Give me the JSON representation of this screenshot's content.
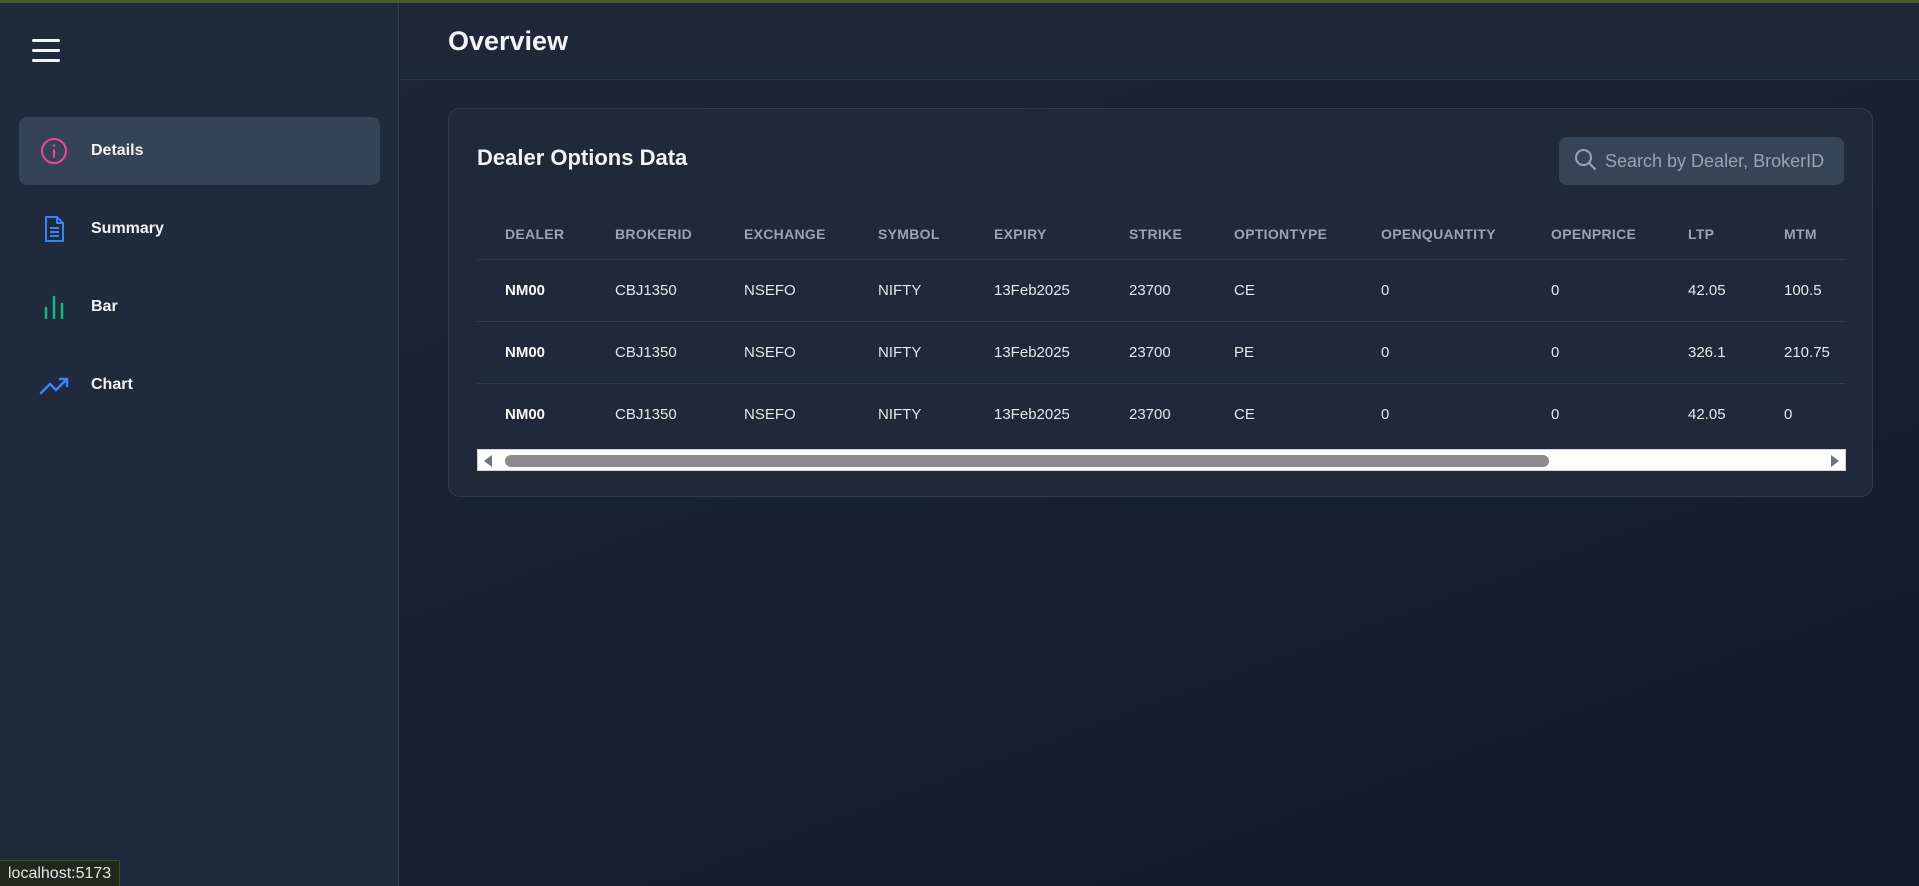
{
  "status_url": "localhost:5173",
  "sidebar": {
    "menu_icon": "hamburger-icon",
    "items": [
      {
        "label": "Details",
        "icon": "info-icon",
        "color": "#ec4899",
        "active": true
      },
      {
        "label": "Summary",
        "icon": "document-icon",
        "color": "#3b82f6",
        "active": false
      },
      {
        "label": "Bar",
        "icon": "bar-chart-icon",
        "color": "#10b981",
        "active": false
      },
      {
        "label": "Chart",
        "icon": "trending-up-icon",
        "color": "#3b82f6",
        "active": false
      }
    ]
  },
  "header": {
    "title": "Overview"
  },
  "card": {
    "title": "Dealer Options Data",
    "search": {
      "placeholder": "Search by Dealer, BrokerID",
      "value": "",
      "icon": "search-icon"
    }
  },
  "table": {
    "columns": [
      "DEALER",
      "BROKERID",
      "EXCHANGE",
      "SYMBOL",
      "EXPIRY",
      "STRIKE",
      "OPTIONTYPE",
      "OPENQUANTITY",
      "OPENPRICE",
      "LTP",
      "MTM"
    ],
    "rows": [
      [
        "NM00",
        "CBJ1350",
        "NSEFO",
        "NIFTY",
        "13Feb2025",
        "23700",
        "CE",
        "0",
        "0",
        "42.05",
        "100.5"
      ],
      [
        "NM00",
        "CBJ1350",
        "NSEFO",
        "NIFTY",
        "13Feb2025",
        "23700",
        "PE",
        "0",
        "0",
        "326.1",
        "210.75"
      ],
      [
        "NM00",
        "CBJ1350",
        "NSEFO",
        "NIFTY",
        "13Feb2025",
        "23700",
        "CE",
        "0",
        "0",
        "42.05",
        "0"
      ]
    ]
  }
}
